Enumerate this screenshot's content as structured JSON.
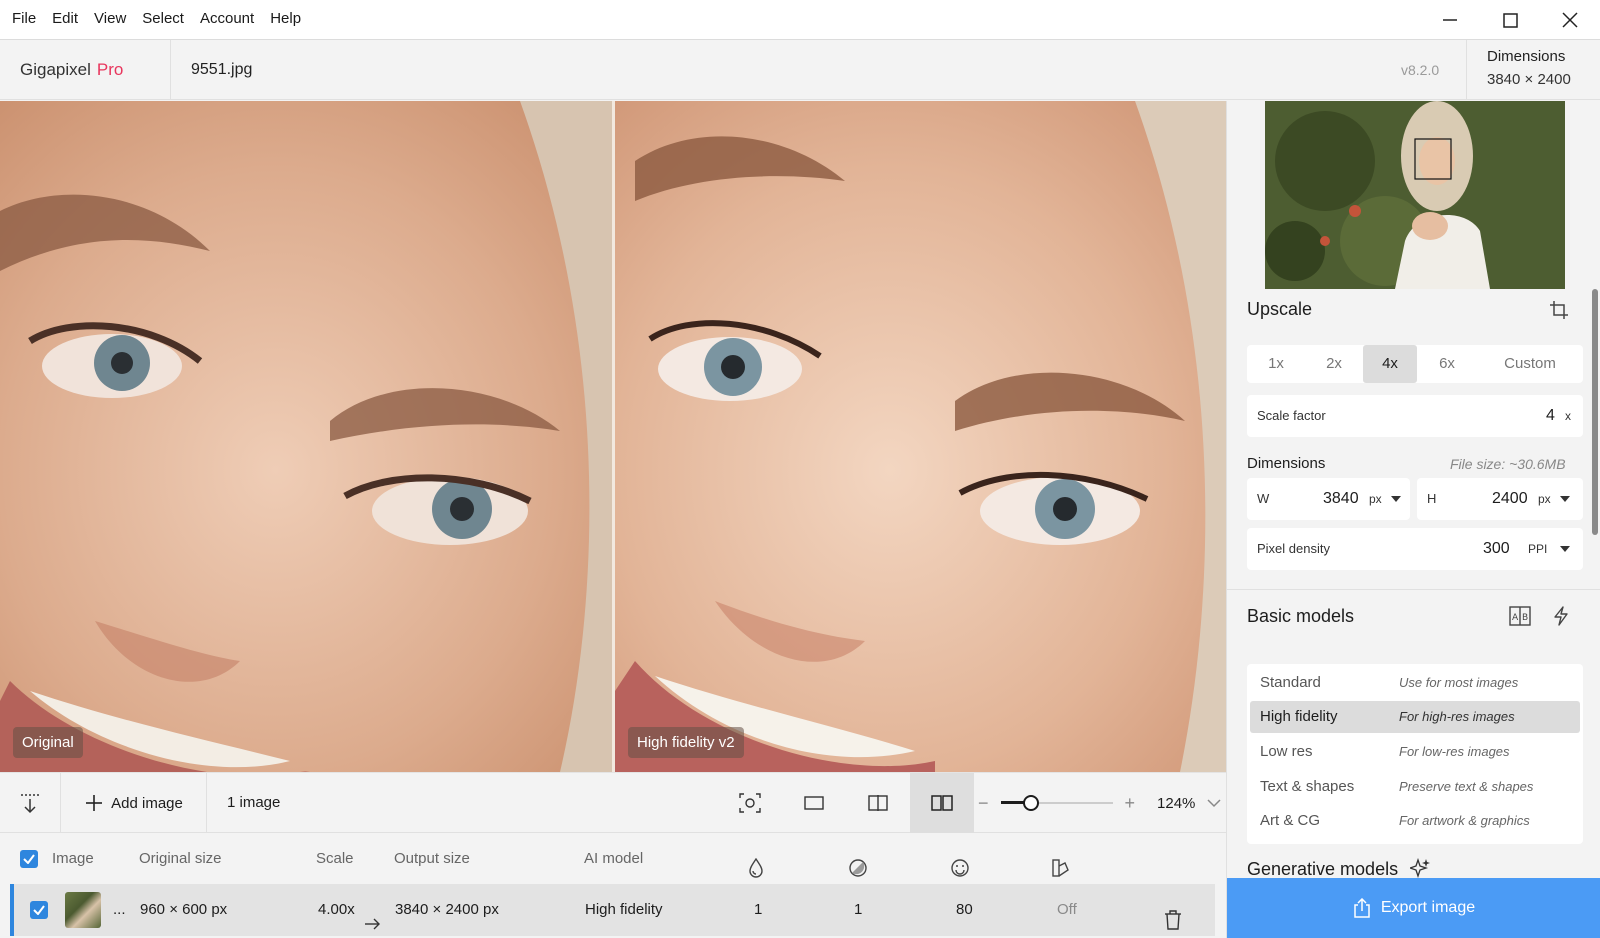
{
  "menu": [
    "File",
    "Edit",
    "View",
    "Select",
    "Account",
    "Help"
  ],
  "header": {
    "brand": "Gigapixel",
    "brand_tier": "Pro",
    "filename": "9551.jpg",
    "version": "v8.2.0",
    "dimensions_title": "Dimensions",
    "dimensions_value": "3840 × 2400"
  },
  "preview": {
    "left_label": "Original",
    "right_label": "High fidelity v2"
  },
  "toolbar": {
    "add_image": "Add image",
    "image_count": "1 image",
    "zoom_minus": "−",
    "zoom_plus": "+",
    "zoom_value": "124%",
    "zoom_level": 0.27
  },
  "table": {
    "headers": {
      "image": "Image",
      "original_size": "Original size",
      "scale": "Scale",
      "output_size": "Output size",
      "ai_model": "AI model"
    },
    "row": {
      "ellipsis": "...",
      "original_size": "960 × 600 px",
      "scale": "4.00x",
      "output_size": "3840 × 2400 px",
      "ai_model": "High fidelity",
      "param1": "1",
      "param2": "1",
      "param3": "80",
      "param4": "Off"
    }
  },
  "panel": {
    "upscale_title": "Upscale",
    "scale_options": [
      "1x",
      "2x",
      "4x",
      "6x",
      "Custom"
    ],
    "scale_selected": "4x",
    "scale_factor_label": "Scale factor",
    "scale_factor_value": "4",
    "scale_factor_unit": "x",
    "dimensions_label": "Dimensions",
    "file_size": "File size: ~30.6MB",
    "width_label": "W",
    "width_value": "3840",
    "width_unit": "px",
    "height_label": "H",
    "height_value": "2400",
    "height_unit": "px",
    "density_label": "Pixel density",
    "density_value": "300",
    "density_unit": "PPI",
    "basic_models_title": "Basic models",
    "models": [
      {
        "name": "Standard",
        "desc": "Use for most images",
        "active": false
      },
      {
        "name": "High fidelity",
        "desc": "For high-res images",
        "active": true
      },
      {
        "name": "Low res",
        "desc": "For low-res images",
        "active": false
      },
      {
        "name": "Text & shapes",
        "desc": "Preserve text & shapes",
        "active": false
      },
      {
        "name": "Art & CG",
        "desc": "For artwork & graphics",
        "active": false
      }
    ],
    "generative_models_title": "Generative models",
    "export_button": "Export image"
  },
  "colors": {
    "accent": "#2e86de",
    "export": "#4b9bf5",
    "brand_pro": "#e8365d"
  }
}
